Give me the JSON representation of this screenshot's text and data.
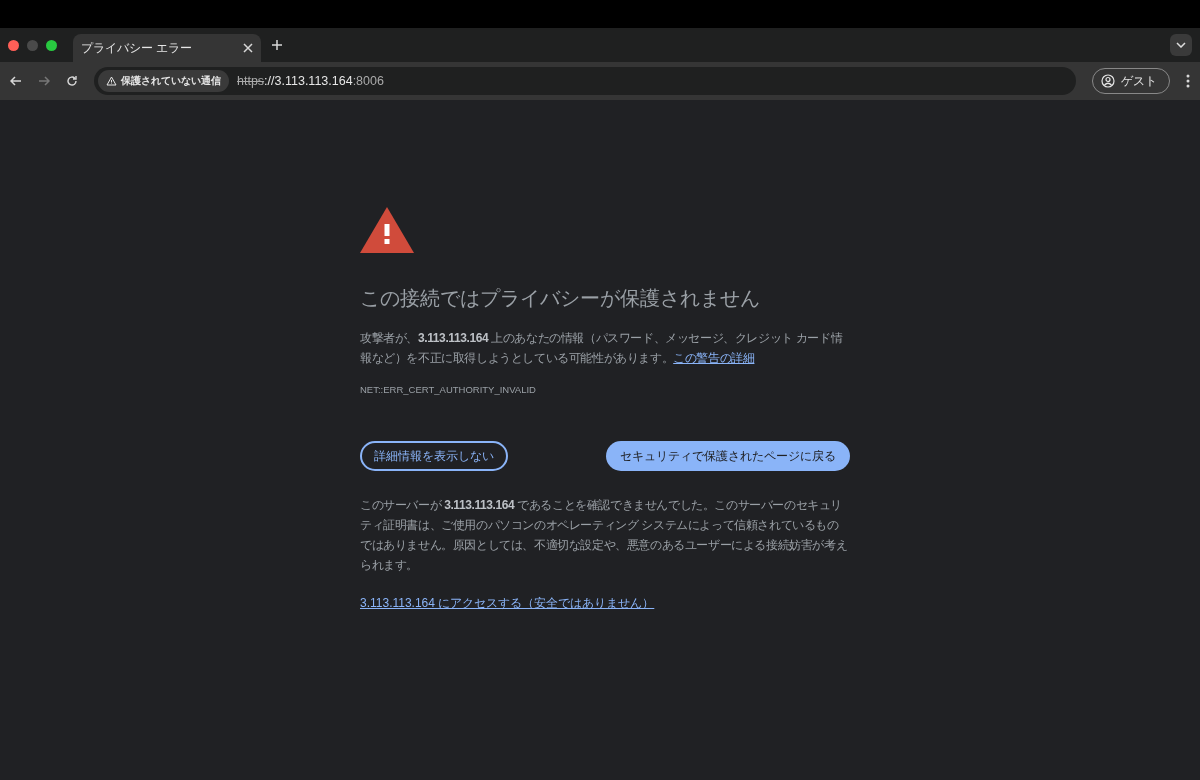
{
  "tab": {
    "title": "プライバシー エラー",
    "selected": true
  },
  "toolbar": {
    "security_chip": "保護されていない通信",
    "url": {
      "scheme": "https",
      "host": "://3.113.113.164",
      "port": ":8006"
    },
    "forward_disabled": true,
    "profile": "ゲスト"
  },
  "interstitial": {
    "heading": "この接続ではプライバシーが保護されません",
    "message": "攻撃者が、**3.113.113.164** 上のあなたの情報（パスワード、メッセージ、クレジット カード情報など）を不正に取得しようとしている可能性があります。",
    "message_link": "この警告の詳細",
    "error_code": "NET::ERR_CERT_AUTHORITY_INVALID",
    "details_button": "詳細情報を表示しない",
    "back_button": "セキュリティで保護されたページに戻る",
    "details_text": "このサーバーが **3.113.113.164** であることを確認できませんでした。このサーバーのセキュリティ証明書は、ご使用のパソコンのオペレーティング システムによって信頼されているものではありません。原因としては、不適切な設定や、悪意のあるユーザーによる接続妨害が考えられます。",
    "proceed_link": "3.113.113.164 にアクセスする（安全ではありません）"
  }
}
